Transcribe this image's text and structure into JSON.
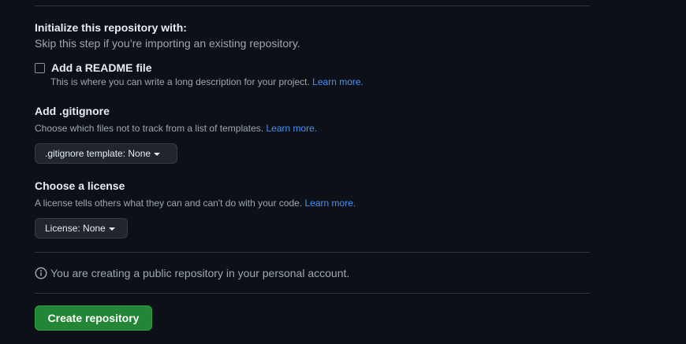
{
  "initialize": {
    "title": "Initialize this repository with:",
    "subtitle": "Skip this step if you’re importing an existing repository."
  },
  "readme": {
    "checked": false,
    "label": "Add a README file",
    "description": "This is where you can write a long description for your project.",
    "link": "Learn more."
  },
  "gitignore": {
    "title": "Add .gitignore",
    "description": "Choose which files not to track from a list of templates.",
    "link": "Learn more.",
    "button_label": ".gitignore template: None"
  },
  "license": {
    "title": "Choose a license",
    "description": "A license tells others what they can and can't do with your code.",
    "link": "Learn more.",
    "button_label": "License: None"
  },
  "info": {
    "icon": "info-icon",
    "text": "You are creating a public repository in your personal account."
  },
  "create_button": {
    "label": "Create repository",
    "color": "#238636"
  },
  "colors": {
    "background": "#0d1117",
    "link": "#4493f8",
    "muted_text": "#9da7b3"
  }
}
